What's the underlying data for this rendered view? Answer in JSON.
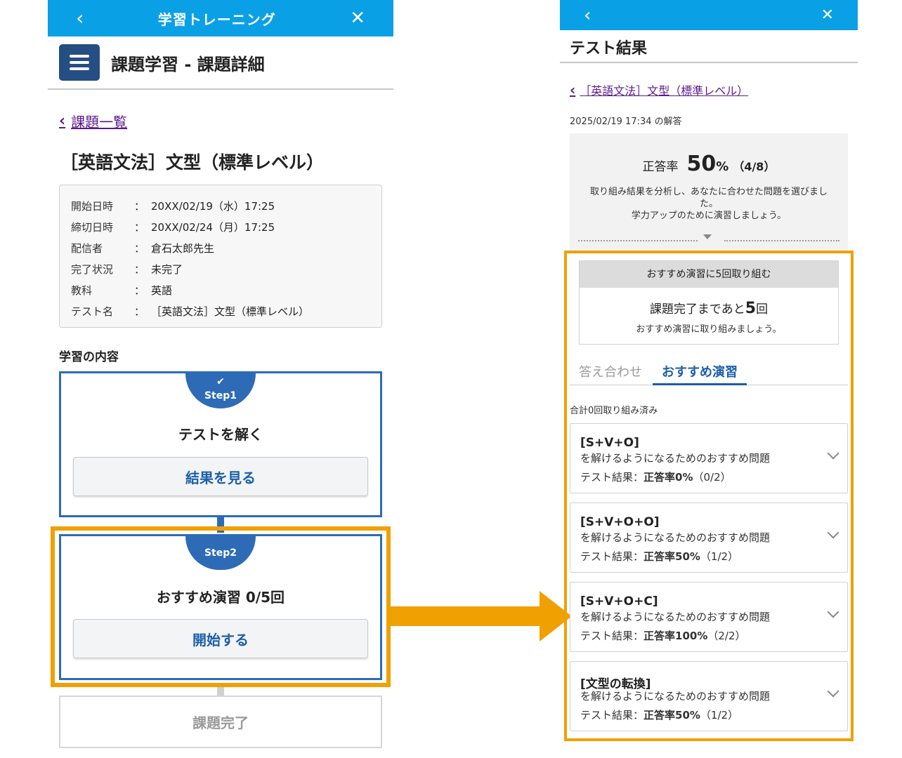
{
  "left": {
    "header": {
      "back_icon": "chevron-left-icon",
      "title": "学習トレーニング",
      "close_icon": "close-icon"
    },
    "page_title": "課題学習 - 課題詳細",
    "back_link": "課題一覧",
    "assignment_title": "［英語文法］文型（標準レベル）",
    "info": [
      {
        "key": "開始日時",
        "colon": "：",
        "value": "20XX/02/19（水）17:25"
      },
      {
        "key": "締切日時",
        "colon": "：",
        "value": "20XX/02/24（月）17:25"
      },
      {
        "key": "配信者",
        "colon": "：",
        "value": "倉石太郎先生"
      },
      {
        "key": "完了状況",
        "colon": "：",
        "value": "未完了"
      },
      {
        "key": "教科",
        "colon": "：",
        "value": "英語"
      },
      {
        "key": "テスト名",
        "colon": "：",
        "value": "［英語文法］文型（標準レベル）"
      }
    ],
    "section_label": "学習の内容",
    "step1": {
      "check": "✔",
      "badge": "Step1",
      "title": "テストを解く",
      "button": "結果を見る"
    },
    "step2": {
      "badge": "Step2",
      "title": "おすすめ演習 0/5回",
      "button": "開始する"
    },
    "complete": "課題完了"
  },
  "right": {
    "header": {
      "back_icon": "chevron-left-icon",
      "close_icon": "close-icon"
    },
    "page_title": "テスト結果",
    "back_link": "［英語文法］文型（標準レベル）",
    "answered_at": "2025/02/19 17:34 の解答",
    "score": {
      "label": "正答率",
      "value": "50",
      "unit": "%",
      "fraction": "（4/8）",
      "message_line1": "取り組み結果を分析し、あなたに合わせた問題を選びまし",
      "message_line2": "た。",
      "message_line3": "学力アップのために演習しましょう。"
    },
    "reco": {
      "head": "おすすめ演習に5回取り組む",
      "remain_prefix": "課題完了まであと",
      "remain_num": "5",
      "remain_suffix": "回",
      "note": "おすすめ演習に取り組みましょう。"
    },
    "tabs": [
      {
        "label": "答え合わせ"
      },
      {
        "label": "おすすめ演習"
      }
    ],
    "total": "合計0回取り組み済み",
    "items": [
      {
        "title": "[S+V+O]",
        "sub": "を解けるようになるためのおすすめ問題",
        "res_label": "テスト結果：",
        "res_rate": "正答率0%",
        "res_frac": "（0/2）"
      },
      {
        "title": "[S+V+O+O]",
        "sub": "を解けるようになるためのおすすめ問題",
        "res_label": "テスト結果：",
        "res_rate": "正答率50%",
        "res_frac": "（1/2）"
      },
      {
        "title": "[S+V+O+C]",
        "sub": "を解けるようになるためのおすすめ問題",
        "res_label": "テスト結果：",
        "res_rate": "正答率100%",
        "res_frac": "（2/2）"
      },
      {
        "title": "[文型の転換]",
        "sub": "を解けるようになるためのおすすめ問題",
        "res_label": "テスト結果：",
        "res_rate": "正答率50%",
        "res_frac": "（1/2）"
      }
    ]
  },
  "colors": {
    "header_blue": "#0aa0e6",
    "accent_blue": "#2e6bb7",
    "highlight_orange": "#f0a000",
    "link_purple": "#5b1a8c"
  }
}
